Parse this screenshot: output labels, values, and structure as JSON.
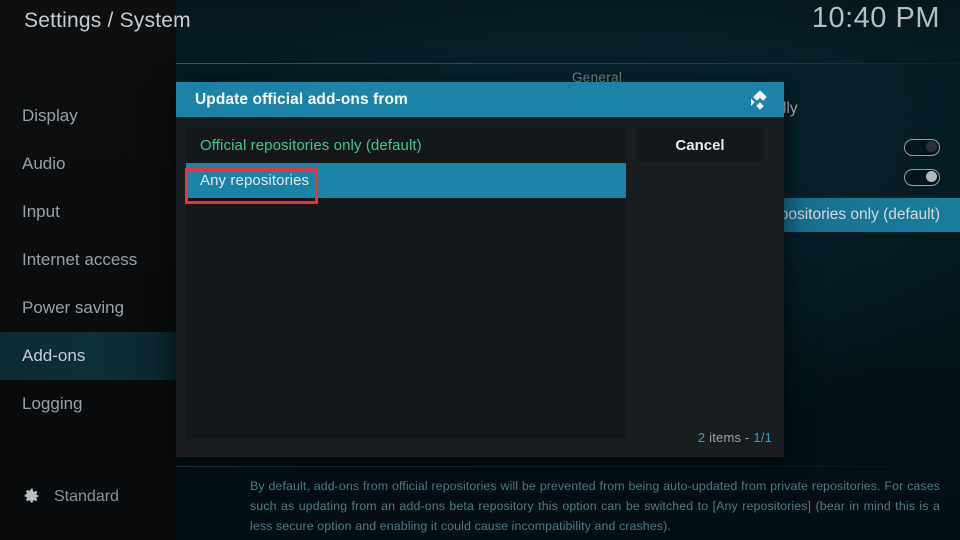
{
  "header": {
    "title": "Settings / System",
    "clock": "10:40 PM"
  },
  "sidebar": {
    "items": [
      {
        "label": "Display",
        "active": false
      },
      {
        "label": "Audio",
        "active": false
      },
      {
        "label": "Input",
        "active": false
      },
      {
        "label": "Internet access",
        "active": false
      },
      {
        "label": "Power saving",
        "active": false
      },
      {
        "label": "Add-ons",
        "active": true
      },
      {
        "label": "Logging",
        "active": false
      }
    ],
    "profile": {
      "icon": "gear-icon",
      "label": "Standard"
    }
  },
  "settings_panel": {
    "section_header": "General",
    "rows": [
      {
        "label": "l updates automatically",
        "control": "text"
      },
      {
        "label": "",
        "control": "toggle",
        "state": "off"
      },
      {
        "label": "",
        "control": "toggle",
        "state": "on"
      }
    ],
    "selected_row_value": "positories only (default)"
  },
  "dialog": {
    "title": "Update official add-ons from",
    "logo_icon": "kodi-logo-icon",
    "options": [
      {
        "label": "Official repositories only (default)",
        "state": "current"
      },
      {
        "label": "Any repositories",
        "state": "selected"
      }
    ],
    "cancel_label": "Cancel",
    "item_count_prefix": "2",
    "item_count_middle": " items - ",
    "item_count_page": "1/1"
  },
  "help_text": "By default, add-ons from official repositories will be prevented from being auto-updated from private repositories. For cases such as updating from an add-ons beta repository this option can be switched to [Any repositories] (bear in mind this is a less secure option and enabling it could cause incompatibility and crashes).",
  "colors": {
    "accent": "#1b83a8",
    "annotation": "#ed3237",
    "current_value": "#3ec98c",
    "help": "#4e7b85"
  }
}
